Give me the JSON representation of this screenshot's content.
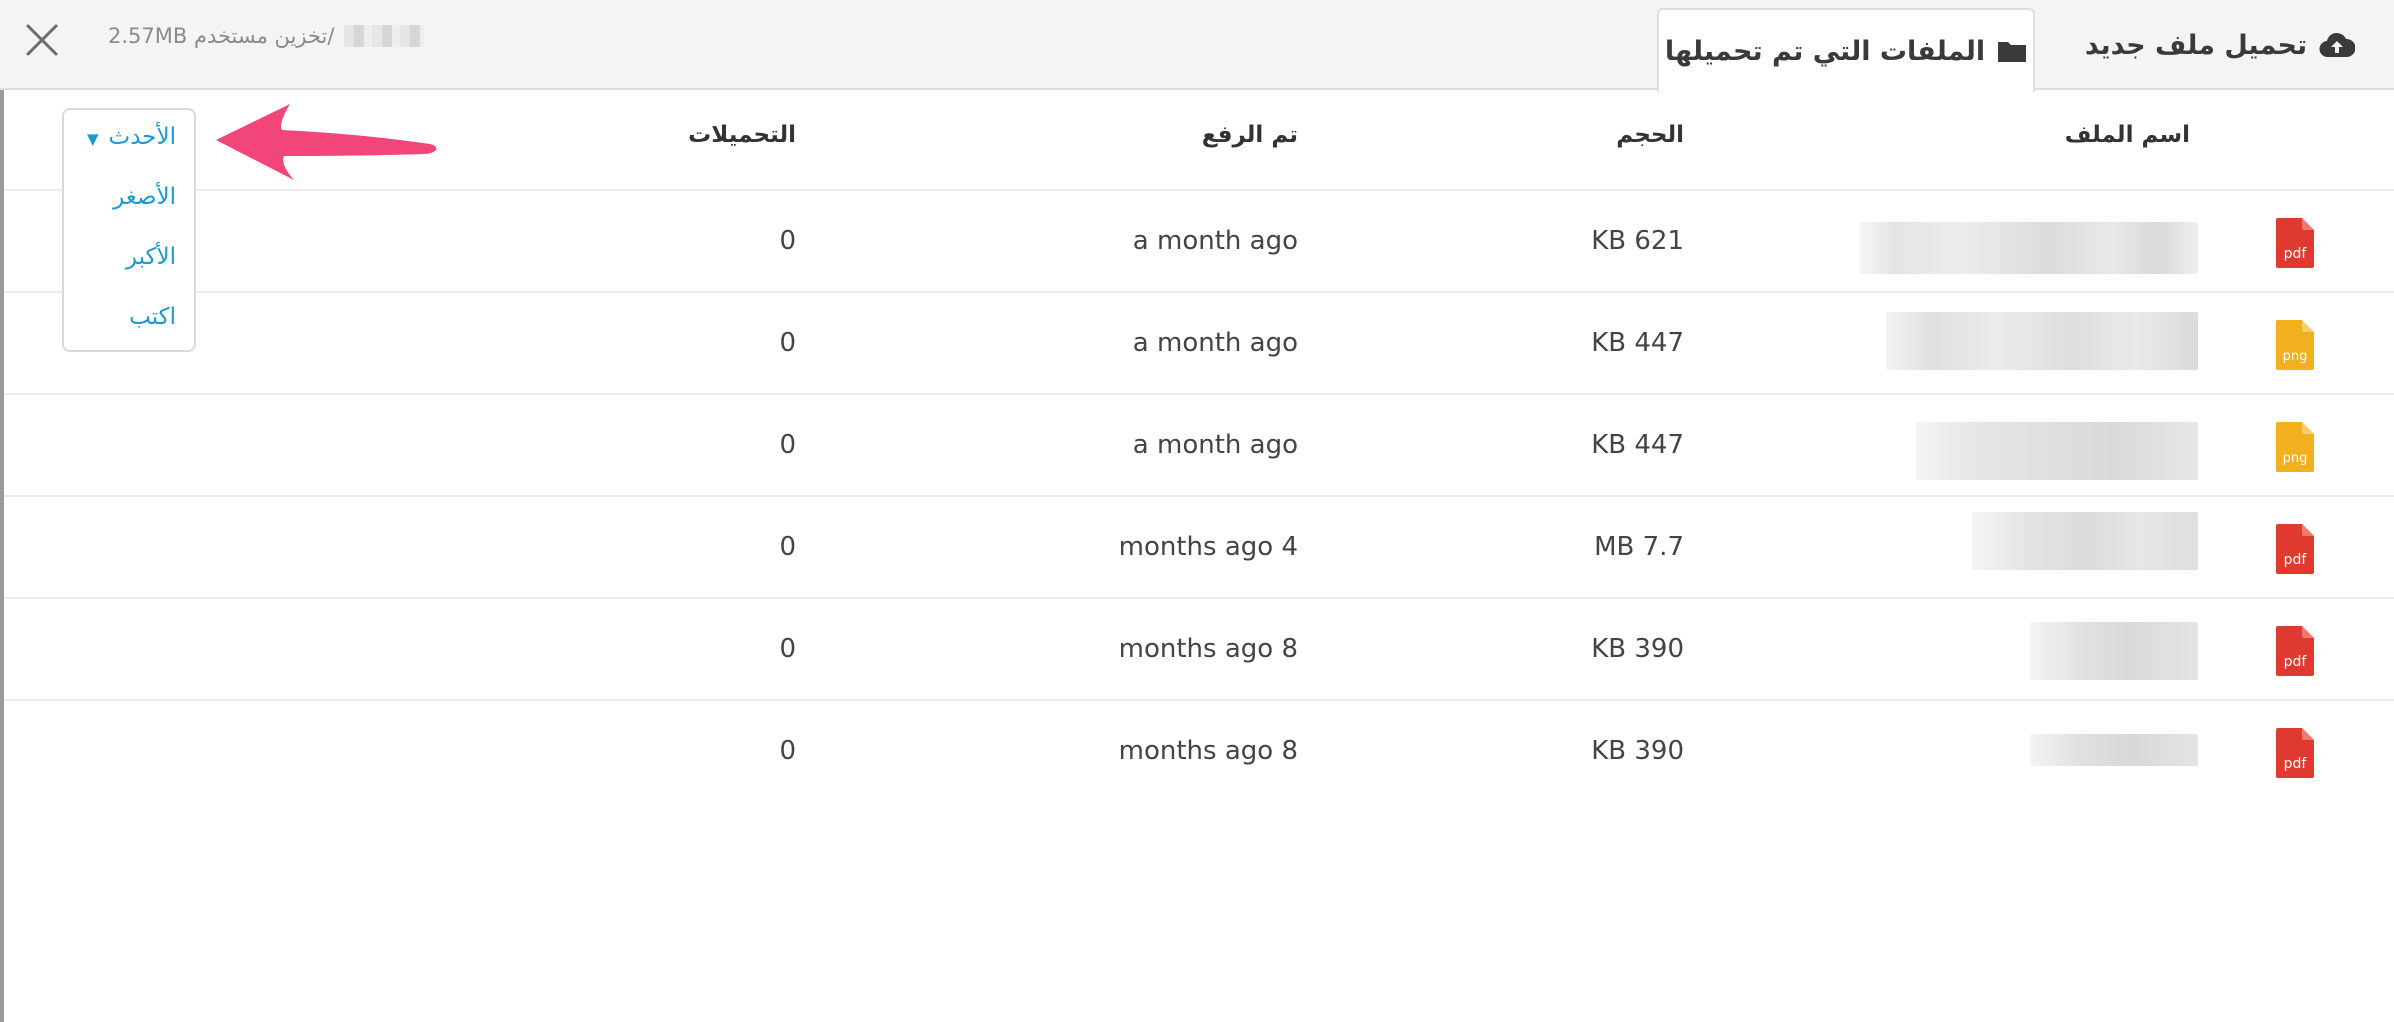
{
  "topbar": {
    "storage_text": "2.57MB تخزين مستخدم",
    "separator": "/"
  },
  "tabs": [
    {
      "label": "الملفات التي تم تحميلها",
      "icon": "folder-icon",
      "active": true
    },
    {
      "label": "تحميل ملف جديد",
      "icon": "cloud-upload-icon",
      "active": false
    }
  ],
  "table": {
    "headers": {
      "file_name": "اسم الملف",
      "size": "الحجم",
      "uploaded": "تم الرفع",
      "downloads": "التحميلات"
    },
    "rows": [
      {
        "type": "pdf",
        "size": "KB 621",
        "uploaded": "a month ago",
        "downloads": "0"
      },
      {
        "type": "png",
        "size": "KB 447",
        "uploaded": "a month ago",
        "downloads": "0"
      },
      {
        "type": "png",
        "size": "KB 447",
        "uploaded": "a month ago",
        "downloads": "0"
      },
      {
        "type": "pdf",
        "size": "MB 7.7",
        "uploaded": "months ago 4",
        "downloads": "0"
      },
      {
        "type": "pdf",
        "size": "KB 390",
        "uploaded": "months ago 8",
        "downloads": "0"
      },
      {
        "type": "pdf",
        "size": "KB 390",
        "uploaded": "months ago 8",
        "downloads": "0"
      }
    ]
  },
  "sort": {
    "selected": "الأحدث",
    "options": [
      "الأصغر",
      "الأكبر",
      "اكتب"
    ]
  },
  "colors": {
    "accent": "#1a9ad1",
    "pdf": "#e0392f",
    "png": "#f2b01e",
    "arrow": "#f2457a"
  }
}
